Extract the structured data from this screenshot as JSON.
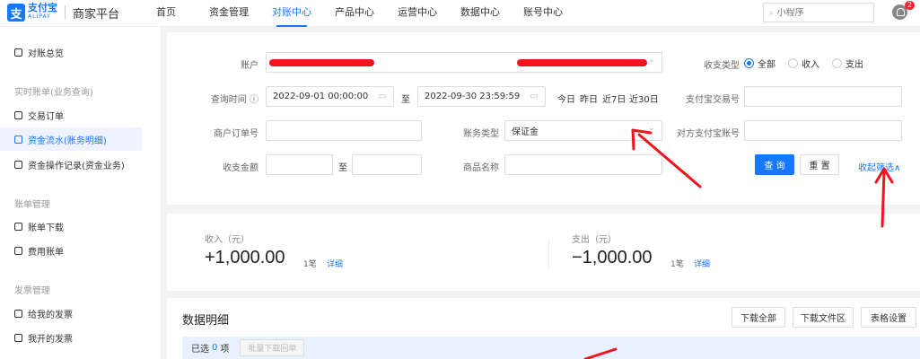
{
  "header": {
    "logo_glyph": "支",
    "logo_name": "支付宝",
    "logo_sub": "ALIPAY",
    "platform": "商家平台",
    "nav": [
      "首页",
      "资金管理",
      "对账中心",
      "产品中心",
      "运营中心",
      "数据中心",
      "账号中心"
    ],
    "active_nav": "对账中心",
    "search_placeholder": "小程序",
    "notification_count": "2"
  },
  "sidebar": {
    "overview": "对账总览",
    "group_realtime": "实时账单(业务查询)",
    "trade_orders": "交易订单",
    "fund_flow": "资金流水(账务明细)",
    "fund_ops": "资金操作记录(资金业务)",
    "group_bill": "账单管理",
    "bill_download": "账单下载",
    "fee_bill": "费用账单",
    "group_invoice": "发票管理",
    "invoice_to_me": "给我的发票",
    "invoice_by_me": "我开的发票"
  },
  "filters": {
    "account_label": "账户",
    "flow_type_label": "收支类型",
    "flow_type_options": [
      "全部",
      "收入",
      "支出"
    ],
    "query_time_label": "查询时间",
    "start_time": "2022-09-01 00:00:00",
    "to_label": "至",
    "end_time": "2022-09-30 23:59:59",
    "quick_today": "今日",
    "quick_yesterday": "昨日",
    "quick_7d": "近7日",
    "quick_30d": "近30日",
    "alipay_trade_no_label": "支付宝交易号",
    "merchant_order_label": "商户订单号",
    "account_type_label": "账务类型",
    "account_type_value": "保证金",
    "counterparty_label": "对方支付宝账号",
    "amount_label": "收支金额",
    "amount_to_label": "至",
    "product_label": "商品名称",
    "query_button": "查 询",
    "reset_button": "重 置",
    "collapse_link": "收起筛选"
  },
  "summary": {
    "income_label": "收入（元）",
    "income_value": "+1,000.00",
    "income_count": "1笔",
    "income_detail": "详细",
    "expense_label": "支出（元）",
    "expense_value": "−1,000.00",
    "expense_count": "1笔",
    "expense_detail": "详细"
  },
  "details": {
    "title": "数据明细",
    "download_all": "下载全部",
    "download_area": "下载文件区",
    "table_settings": "表格设置",
    "selected_prefix": "已选",
    "selected_count": "0",
    "selected_suffix": "项",
    "batch_download": "批量下载回单"
  },
  "colors": {
    "brand": "#1677ff",
    "annotation_red": "#f0141e"
  }
}
